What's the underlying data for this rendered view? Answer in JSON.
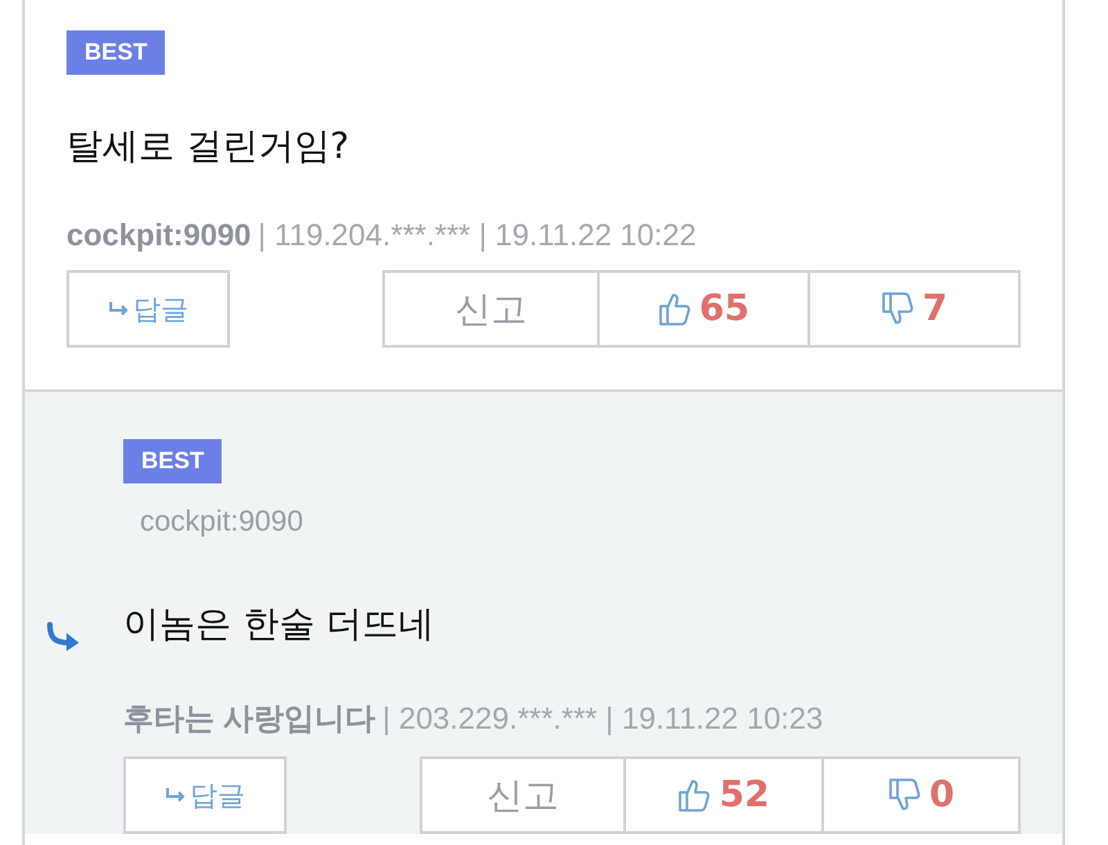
{
  "comments": [
    {
      "kind": "comment",
      "badge": "BEST",
      "text": "탈세로 걸린거임?",
      "author": "cockpit:9090",
      "info": "| 119.204.***.*** | 19.11.22 10:22",
      "reply_button": "답글",
      "report_button": "신고",
      "likes": "65",
      "dislikes": "7"
    },
    {
      "kind": "reply",
      "badge": "BEST",
      "reply_to": "cockpit:9090",
      "text": "이놈은 한술 더뜨네",
      "author": "후타는 사랑입니다",
      "info": "| 203.229.***.*** | 19.11.22 10:23",
      "reply_button": "답글",
      "report_button": "신고",
      "likes": "52",
      "dislikes": "0"
    }
  ]
}
